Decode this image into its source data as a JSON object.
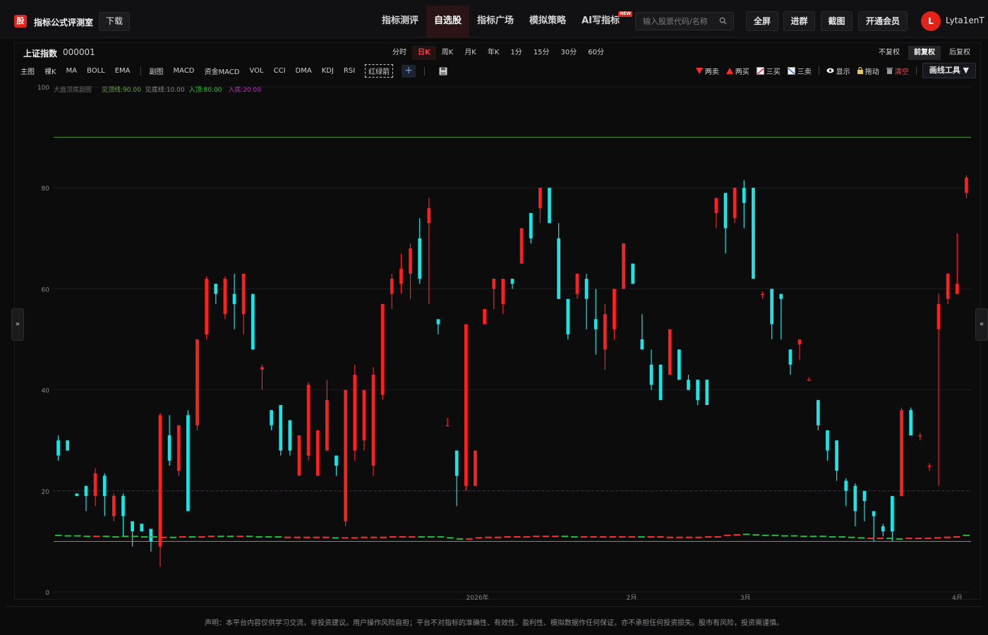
{
  "header": {
    "logo_char": "股",
    "app_title": "指标公式评测室",
    "download_label": "下载",
    "nav": [
      {
        "label": "指标测评",
        "active": false
      },
      {
        "label": "自选股",
        "active": true
      },
      {
        "label": "指标广场",
        "active": false
      },
      {
        "label": "模拟策略",
        "active": false
      },
      {
        "label": "AI写指标",
        "active": false,
        "badge": "NEW"
      }
    ],
    "search_placeholder": "输入股票代码/名称",
    "buttons": {
      "fullscreen": "全屏",
      "join": "进群",
      "screenshot": "截图",
      "vip": "开通会员"
    },
    "avatar_letter": "L",
    "username": "Lyta1enT"
  },
  "toolbar": {
    "stock_name": "上证指数",
    "stock_code": "000001",
    "periods": [
      {
        "label": "分时",
        "active": false
      },
      {
        "label": "日K",
        "active": true
      },
      {
        "label": "周K",
        "active": false
      },
      {
        "label": "月K",
        "active": false
      },
      {
        "label": "年K",
        "active": false
      },
      {
        "label": "1分",
        "active": false
      },
      {
        "label": "15分",
        "active": false
      },
      {
        "label": "30分",
        "active": false
      },
      {
        "label": "60分",
        "active": false
      }
    ],
    "adjust": [
      {
        "label": "不复权",
        "active": false
      },
      {
        "label": "前复权",
        "active": true
      },
      {
        "label": "后复权",
        "active": false
      }
    ],
    "main_indicators": [
      "主图",
      "裸K",
      "MA",
      "BOLL",
      "EMA"
    ],
    "sub_indicators": [
      "副图",
      "MACD",
      "资金MACD",
      "VOL",
      "CCI",
      "DMA",
      "KDJ",
      "RSI"
    ],
    "selected_indicator": "红绿箭",
    "add_label": "+",
    "draw_tools": [
      {
        "label": "两卖",
        "icon": "down-triangle-icon"
      },
      {
        "label": "两买",
        "icon": "up-triangle-icon"
      },
      {
        "label": "三买",
        "icon": "line-up-icon"
      },
      {
        "label": "三卖",
        "icon": "line-down-icon"
      }
    ],
    "show_label": "显示",
    "drag_label": "拖动",
    "clear_label": "清空",
    "draw_menu_label": "画线工具 ▼"
  },
  "chart_data": {
    "type": "candlestick",
    "y_ticks": [
      0,
      20,
      40,
      60,
      80,
      100
    ],
    "ylim": [
      0,
      100
    ],
    "x_tick_labels": [
      "2026年",
      "2月",
      "3月",
      "4月"
    ],
    "legend": {
      "title": "大盘顶底副图",
      "items": [
        {
          "label": "见顶线:90.00",
          "color": "#6aa83c"
        },
        {
          "label": "见底线:10.00",
          "color": "#8a8a8a"
        },
        {
          "label": "入顶:80.00",
          "color": "#21d021"
        },
        {
          "label": "入底:20.00",
          "color": "#d020d0"
        }
      ]
    },
    "reference_lines": {
      "top": 90,
      "bottom": 10,
      "buy_top": 80,
      "buy_bottom": 20
    },
    "colors": {
      "up": "#ff1f1f",
      "down": "#1fe3e3",
      "top_line": "#5f9a34",
      "bottom_line": "#8a8a8a",
      "dotted": "#c020c0",
      "baseline_green": "#20c040",
      "baseline_red": "#ff3030"
    },
    "candles": [
      {
        "o": 30,
        "c": 27,
        "h": 31,
        "l": 26
      },
      {
        "o": 30,
        "c": 28,
        "h": 30,
        "l": 28
      },
      {
        "o": 19.5,
        "c": 19,
        "h": 19.5,
        "l": 19
      },
      {
        "o": 21,
        "c": 19,
        "h": 21,
        "l": 16
      },
      {
        "o": 19,
        "c": 23.5,
        "h": 24.5,
        "l": 17
      },
      {
        "o": 23,
        "c": 19,
        "h": 23.5,
        "l": 15
      },
      {
        "o": 15,
        "c": 19,
        "h": 19.5,
        "l": 14
      },
      {
        "o": 19,
        "c": 15,
        "h": 19.5,
        "l": 11
      },
      {
        "o": 14,
        "c": 12,
        "h": 14,
        "l": 9
      },
      {
        "o": 13.5,
        "c": 12,
        "h": 13.5,
        "l": 12
      },
      {
        "o": 12.5,
        "c": 10,
        "h": 12.5,
        "l": 8
      },
      {
        "o": 9,
        "c": 35,
        "h": 35.5,
        "l": 5
      },
      {
        "o": 31,
        "c": 26,
        "h": 35,
        "l": 25
      },
      {
        "o": 24,
        "c": 33,
        "h": 33,
        "l": 23
      },
      {
        "o": 35,
        "c": 16,
        "h": 36,
        "l": 16
      },
      {
        "o": 33,
        "c": 50,
        "h": 50,
        "l": 32
      },
      {
        "o": 51,
        "c": 62,
        "h": 62.5,
        "l": 50
      },
      {
        "o": 61,
        "c": 59,
        "h": 61,
        "l": 57
      },
      {
        "o": 55,
        "c": 62,
        "h": 62.5,
        "l": 54
      },
      {
        "o": 59,
        "c": 57,
        "h": 63,
        "l": 52
      },
      {
        "o": 55,
        "c": 63,
        "h": 63,
        "l": 51
      },
      {
        "o": 59,
        "c": 48,
        "h": 59,
        "l": 48
      },
      {
        "o": 44,
        "c": 44.5,
        "h": 45,
        "l": 40
      },
      {
        "o": 36,
        "c": 33,
        "h": 36,
        "l": 32
      },
      {
        "o": 37,
        "c": 28,
        "h": 37,
        "l": 27
      },
      {
        "o": 34,
        "c": 28,
        "h": 34,
        "l": 27
      },
      {
        "o": 23,
        "c": 31,
        "h": 31,
        "l": 23
      },
      {
        "o": 27,
        "c": 41,
        "h": 41.5,
        "l": 26
      },
      {
        "o": 23,
        "c": 32,
        "h": 32,
        "l": 23
      },
      {
        "o": 28,
        "c": 38,
        "h": 42,
        "l": 28
      },
      {
        "o": 27,
        "c": 25,
        "h": 27,
        "l": 23
      },
      {
        "o": 14,
        "c": 40,
        "h": 40,
        "l": 13
      },
      {
        "o": 28,
        "c": 43,
        "h": 45,
        "l": 26
      },
      {
        "o": 30,
        "c": 40,
        "h": 40,
        "l": 28
      },
      {
        "o": 25,
        "c": 43,
        "h": 44.5,
        "l": 23
      },
      {
        "o": 39,
        "c": 57,
        "h": 57,
        "l": 38
      },
      {
        "o": 59,
        "c": 62,
        "h": 63,
        "l": 56
      },
      {
        "o": 61,
        "c": 64,
        "h": 67,
        "l": 59
      },
      {
        "o": 63,
        "c": 68,
        "h": 69,
        "l": 58
      },
      {
        "o": 70,
        "c": 62,
        "h": 74,
        "l": 61
      },
      {
        "o": 73,
        "c": 76,
        "h": 78,
        "l": 57
      },
      {
        "o": 54,
        "c": 53,
        "h": 53.5,
        "l": 51
      },
      {
        "o": 33,
        "c": 33,
        "h": 34.5,
        "l": 33
      },
      {
        "o": 28,
        "c": 23,
        "h": 28,
        "l": 17
      },
      {
        "o": 21,
        "c": 53,
        "h": 53,
        "l": 20
      },
      {
        "o": 21,
        "c": 28,
        "h": 28,
        "l": 21
      },
      {
        "o": 53,
        "c": 56,
        "h": 56,
        "l": 54
      },
      {
        "o": 60,
        "c": 62,
        "h": 62,
        "l": 56
      },
      {
        "o": 57,
        "c": 62,
        "h": 62,
        "l": 55
      },
      {
        "o": 62,
        "c": 61,
        "h": 61,
        "l": 60
      },
      {
        "o": 65,
        "c": 72,
        "h": 72,
        "l": 65
      },
      {
        "o": 75,
        "c": 70,
        "h": 75,
        "l": 69
      },
      {
        "o": 76,
        "c": 80,
        "h": 80,
        "l": 73
      },
      {
        "o": 80,
        "c": 73,
        "h": 80,
        "l": 73
      },
      {
        "o": 70,
        "c": 58,
        "h": 73,
        "l": 58
      },
      {
        "o": 58,
        "c": 51,
        "h": 58,
        "l": 50
      },
      {
        "o": 59,
        "c": 63,
        "h": 63,
        "l": 58
      },
      {
        "o": 62,
        "c": 58,
        "h": 63,
        "l": 52
      },
      {
        "o": 54,
        "c": 52,
        "h": 60,
        "l": 47
      },
      {
        "o": 48,
        "c": 55,
        "h": 57,
        "l": 44
      },
      {
        "o": 52,
        "c": 60,
        "h": 60,
        "l": 50
      },
      {
        "o": 60,
        "c": 69,
        "h": 69,
        "l": 60
      },
      {
        "o": 65,
        "c": 61,
        "h": 65,
        "l": 61
      },
      {
        "o": 50,
        "c": 48,
        "h": 55,
        "l": 48
      },
      {
        "o": 45,
        "c": 41,
        "h": 48,
        "l": 40
      },
      {
        "o": 45,
        "c": 38,
        "h": 45,
        "l": 38
      },
      {
        "o": 43,
        "c": 52,
        "h": 52,
        "l": 43
      },
      {
        "o": 48,
        "c": 42,
        "h": 48,
        "l": 42
      },
      {
        "o": 42,
        "c": 40,
        "h": 43,
        "l": 40
      },
      {
        "o": 42,
        "c": 38,
        "h": 42,
        "l": 37
      },
      {
        "o": 42,
        "c": 37,
        "h": 42,
        "l": 37
      },
      {
        "o": 75,
        "c": 78,
        "h": 78,
        "l": 72
      },
      {
        "o": 79,
        "c": 72,
        "h": 79,
        "l": 67
      },
      {
        "o": 74,
        "c": 80,
        "h": 80,
        "l": 73
      },
      {
        "o": 80,
        "c": 77,
        "h": 81.5,
        "l": 72
      },
      {
        "o": 80,
        "c": 62,
        "h": 80,
        "l": 62
      },
      {
        "o": 59,
        "c": 59,
        "h": 59.5,
        "l": 58
      },
      {
        "o": 60,
        "c": 53,
        "h": 60,
        "l": 50
      },
      {
        "o": 59,
        "c": 58,
        "h": 59,
        "l": 50
      },
      {
        "o": 48,
        "c": 45,
        "h": 48,
        "l": 43
      },
      {
        "o": 49,
        "c": 50,
        "h": 50,
        "l": 46
      },
      {
        "o": 42,
        "c": 42,
        "h": 42.5,
        "l": 42
      },
      {
        "o": 38,
        "c": 33,
        "h": 38,
        "l": 32
      },
      {
        "o": 32,
        "c": 28,
        "h": 32,
        "l": 26
      },
      {
        "o": 30,
        "c": 24,
        "h": 30,
        "l": 22
      },
      {
        "o": 22,
        "c": 20,
        "h": 22.5,
        "l": 17
      },
      {
        "o": 21,
        "c": 16,
        "h": 21.5,
        "l": 13
      },
      {
        "o": 20,
        "c": 18,
        "h": 20,
        "l": 14
      },
      {
        "o": 16,
        "c": 15,
        "h": 16,
        "l": 10
      },
      {
        "o": 13,
        "c": 12,
        "h": 13.5,
        "l": 11
      },
      {
        "o": 19,
        "c": 12,
        "h": 19,
        "l": 10
      },
      {
        "o": 19,
        "c": 36,
        "h": 36.5,
        "l": 19
      },
      {
        "o": 36,
        "c": 31,
        "h": 36.5,
        "l": 31
      },
      {
        "o": 31,
        "c": 31,
        "h": 31.5,
        "l": 30
      },
      {
        "o": 25,
        "c": 25,
        "h": 25.5,
        "l": 24
      },
      {
        "o": 52,
        "c": 57,
        "h": 59,
        "l": 21
      },
      {
        "o": 58,
        "c": 63,
        "h": 63,
        "l": 57
      },
      {
        "o": 59,
        "c": 61,
        "h": 71,
        "l": 59
      },
      {
        "o": 79,
        "c": 82,
        "h": 82.5,
        "l": 78
      }
    ],
    "baseline_dashes": [
      {
        "v": 11.2,
        "c": "g"
      },
      {
        "v": 11.1,
        "c": "g"
      },
      {
        "v": 11.1,
        "c": "g"
      },
      {
        "v": 11,
        "c": "g"
      },
      {
        "v": 11,
        "c": "r"
      },
      {
        "v": 11,
        "c": "g"
      },
      {
        "v": 10.9,
        "c": "g"
      },
      {
        "v": 11,
        "c": "g"
      },
      {
        "v": 11,
        "c": "g"
      },
      {
        "v": 10.9,
        "c": "g"
      },
      {
        "v": 10.9,
        "c": "g"
      },
      {
        "v": 10.8,
        "c": "r"
      },
      {
        "v": 10.8,
        "c": "g"
      },
      {
        "v": 10.9,
        "c": "r"
      },
      {
        "v": 10.9,
        "c": "g"
      },
      {
        "v": 10.9,
        "c": "r"
      },
      {
        "v": 11,
        "c": "r"
      },
      {
        "v": 11,
        "c": "g"
      },
      {
        "v": 11,
        "c": "g"
      },
      {
        "v": 11,
        "c": "r"
      },
      {
        "v": 11,
        "c": "g"
      },
      {
        "v": 10.9,
        "c": "g"
      },
      {
        "v": 10.9,
        "c": "g"
      },
      {
        "v": 10.9,
        "c": "g"
      },
      {
        "v": 10.8,
        "c": "r"
      },
      {
        "v": 10.8,
        "c": "r"
      },
      {
        "v": 10.8,
        "c": "r"
      },
      {
        "v": 10.8,
        "c": "r"
      },
      {
        "v": 10.8,
        "c": "r"
      },
      {
        "v": 10.7,
        "c": "g"
      },
      {
        "v": 10.7,
        "c": "r"
      },
      {
        "v": 10.7,
        "c": "r"
      },
      {
        "v": 10.8,
        "c": "r"
      },
      {
        "v": 10.8,
        "c": "r"
      },
      {
        "v": 10.8,
        "c": "r"
      },
      {
        "v": 10.9,
        "c": "r"
      },
      {
        "v": 10.9,
        "c": "r"
      },
      {
        "v": 10.9,
        "c": "r"
      },
      {
        "v": 10.9,
        "c": "g"
      },
      {
        "v": 10.9,
        "c": "g"
      },
      {
        "v": 10.9,
        "c": "g"
      },
      {
        "v": 10.7,
        "c": "g"
      },
      {
        "v": 10.5,
        "c": "g"
      },
      {
        "v": 10.5,
        "c": "r"
      },
      {
        "v": 10.7,
        "c": "r"
      },
      {
        "v": 10.8,
        "c": "r"
      },
      {
        "v": 10.8,
        "c": "r"
      },
      {
        "v": 10.9,
        "c": "r"
      },
      {
        "v": 10.9,
        "c": "r"
      },
      {
        "v": 10.9,
        "c": "r"
      },
      {
        "v": 11,
        "c": "r"
      },
      {
        "v": 11,
        "c": "r"
      },
      {
        "v": 11,
        "c": "r"
      },
      {
        "v": 11,
        "c": "g"
      },
      {
        "v": 10.9,
        "c": "g"
      },
      {
        "v": 10.9,
        "c": "r"
      },
      {
        "v": 10.9,
        "c": "r"
      },
      {
        "v": 10.9,
        "c": "r"
      },
      {
        "v": 10.9,
        "c": "r"
      },
      {
        "v": 10.9,
        "c": "r"
      },
      {
        "v": 10.9,
        "c": "r"
      },
      {
        "v": 10.9,
        "c": "g"
      },
      {
        "v": 10.9,
        "c": "r"
      },
      {
        "v": 10.9,
        "c": "r"
      },
      {
        "v": 10.8,
        "c": "r"
      },
      {
        "v": 10.8,
        "c": "r"
      },
      {
        "v": 10.8,
        "c": "r"
      },
      {
        "v": 10.8,
        "c": "r"
      },
      {
        "v": 10.9,
        "c": "r"
      },
      {
        "v": 10.9,
        "c": "r"
      },
      {
        "v": 11.2,
        "c": "r"
      },
      {
        "v": 11.3,
        "c": "r"
      },
      {
        "v": 11.4,
        "c": "g"
      },
      {
        "v": 11.3,
        "c": "g"
      },
      {
        "v": 11.2,
        "c": "g"
      },
      {
        "v": 11.2,
        "c": "g"
      },
      {
        "v": 11.1,
        "c": "g"
      },
      {
        "v": 11.1,
        "c": "g"
      },
      {
        "v": 11,
        "c": "g"
      },
      {
        "v": 11,
        "c": "g"
      },
      {
        "v": 11,
        "c": "g"
      },
      {
        "v": 10.9,
        "c": "g"
      },
      {
        "v": 10.9,
        "c": "g"
      },
      {
        "v": 10.8,
        "c": "g"
      },
      {
        "v": 10.7,
        "c": "g"
      },
      {
        "v": 10.6,
        "c": "r"
      },
      {
        "v": 10.6,
        "c": "r"
      },
      {
        "v": 10.6,
        "c": "g"
      },
      {
        "v": 10.5,
        "c": "g"
      },
      {
        "v": 10.6,
        "c": "r"
      },
      {
        "v": 10.6,
        "c": "r"
      },
      {
        "v": 10.6,
        "c": "r"
      },
      {
        "v": 10.7,
        "c": "r"
      },
      {
        "v": 10.8,
        "c": "r"
      },
      {
        "v": 10.9,
        "c": "r"
      },
      {
        "v": 11.2,
        "c": "g"
      }
    ]
  },
  "side": {
    "left_handle": "»",
    "right_handle": "«"
  },
  "footer": {
    "disclaimer": "声明：本平台内容仅供学习交流，非投资建议。用户操作风险自担；平台不对指标的准确性、有效性、盈利性、模拟数据作任何保证，亦不承担任何投资损失。股市有风险，投资需谨慎。"
  }
}
